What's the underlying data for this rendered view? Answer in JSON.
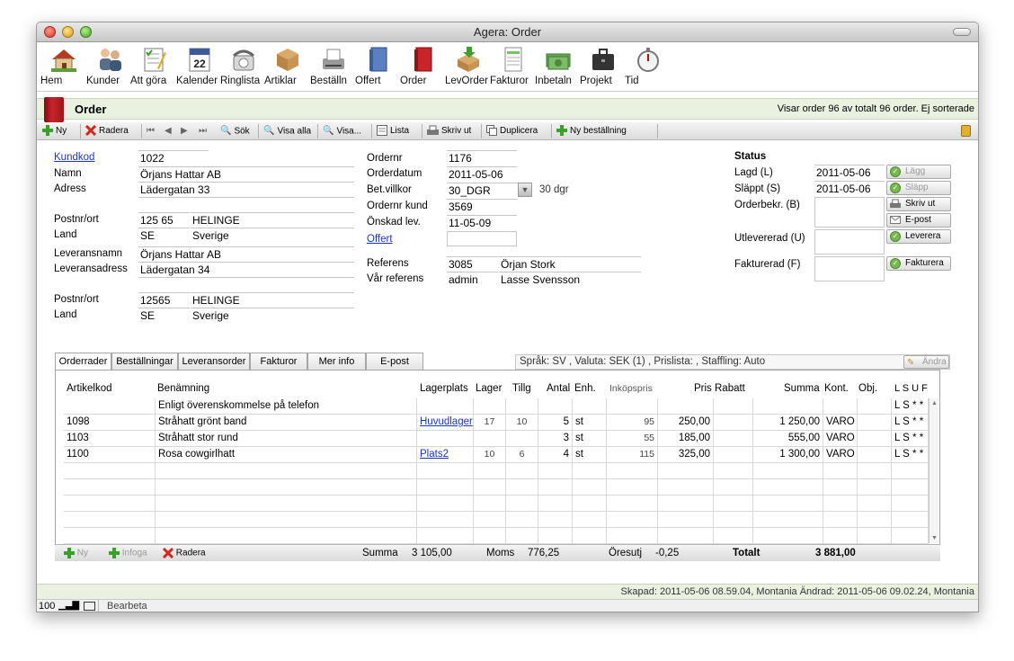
{
  "window": {
    "title": "Agera: Order"
  },
  "toolbar": [
    {
      "label": "Hem",
      "icon": "home-icon"
    },
    {
      "label": "Kunder",
      "icon": "customers-icon"
    },
    {
      "label": "Att göra",
      "icon": "todo-icon"
    },
    {
      "label": "Kalender",
      "icon": "calendar-icon"
    },
    {
      "label": "Ringlista",
      "icon": "phone-icon"
    },
    {
      "label": "Artiklar",
      "icon": "box-icon"
    },
    {
      "label": "Beställn",
      "icon": "fax-icon"
    },
    {
      "label": "Offert",
      "icon": "offer-book-icon"
    },
    {
      "label": "Order",
      "icon": "order-book-icon"
    },
    {
      "label": "LevOrder",
      "icon": "delivery-icon"
    },
    {
      "label": "Fakturor",
      "icon": "invoice-icon"
    },
    {
      "label": "Inbetaln",
      "icon": "money-icon"
    },
    {
      "label": "Projekt",
      "icon": "briefcase-icon"
    },
    {
      "label": "Tid",
      "icon": "stopwatch-icon"
    }
  ],
  "header": {
    "title": "Order",
    "info": "Visar order 96 av totalt 96 order. Ej sorterade"
  },
  "actions": {
    "new": "Ny",
    "delete": "Radera",
    "search": "Sök",
    "show_all": "Visa alla",
    "show": "Visa...",
    "list": "Lista",
    "print": "Skriv ut",
    "duplicate": "Duplicera",
    "new_purchase": "Ny beställning"
  },
  "customer": {
    "kundkod_label": "Kundkod",
    "kundkod": "1022",
    "namn_label": "Namn",
    "namn": "Örjans Hattar AB",
    "adress_label": "Adress",
    "adress": "Lädergatan 33",
    "adress2": "",
    "postnr_label": "Postnr/ort",
    "postnr": "125 65",
    "ort": "HELINGE",
    "land_label": "Land",
    "land_code": "SE",
    "land": "Sverige",
    "levnamn_label": "Leveransnamn",
    "levnamn": "Örjans Hattar AB",
    "levadress_label": "Leveransadress",
    "levadress": "Lädergatan 34",
    "levadress2": "",
    "levpostnr_label": "Postnr/ort",
    "levpostnr": "12565",
    "levort": "HELINGE",
    "levland_label": "Land",
    "levland_code": "SE",
    "levland": "Sverige"
  },
  "order": {
    "ordernr_label": "Ordernr",
    "ordernr": "1176",
    "orderdatum_label": "Orderdatum",
    "orderdatum": "2011-05-06",
    "betvillkor_label": "Bet.villkor",
    "betvillkor": "30_DGR",
    "betvillkor_text": "30 dgr",
    "ordernrkund_label": "Ordernr kund",
    "ordernrkund": "3569",
    "onskadlev_label": "Önskad lev.",
    "onskadlev": "11-05-09",
    "offert_label": "Offert",
    "offert": "",
    "referens_label": "Referens",
    "referens_id": "3085",
    "referens_namn": "Örjan Stork",
    "varref_label": "Vår referens",
    "varref_id": "admin",
    "varref_namn": "Lasse Svensson"
  },
  "status": {
    "title": "Status",
    "lagd_label": "Lagd (L)",
    "lagd": "2011-05-06",
    "lagg_btn": "Lägg",
    "slappt_label": "Släppt (S)",
    "slappt": "2011-05-06",
    "slapp_btn": "Släpp",
    "orderbekr_label": "Orderbekr. (B)",
    "skrivut_btn": "Skriv ut",
    "epost_btn": "E-post",
    "utlevererad_label": "Utlevererad (U)",
    "leverera_btn": "Leverera",
    "fakturerad_label": "Fakturerad (F)",
    "fakturera_btn": "Fakturera"
  },
  "tabs": [
    "Orderrader",
    "Beställningar",
    "Leveransorder",
    "Fakturor",
    "Mer info",
    "E-post"
  ],
  "langbar": "Språk: SV , Valuta: SEK (1) , Prislista:  , Staffling: Auto",
  "andra_btn": "Ändra",
  "grid": {
    "headers": [
      "Artikelkod",
      "Benämning",
      "Lagerplats",
      "Lager",
      "Tillg",
      "Antal",
      "Enh.",
      "Inköpspris",
      "Pris",
      "Rabatt",
      "Summa",
      "Kont.",
      "Obj.",
      "L S U F"
    ],
    "rows": [
      {
        "kod": "",
        "ben": "Enligt överenskommelse på telefon",
        "lagerplats": "",
        "lager": "",
        "tillg": "",
        "antal": "",
        "enh": "",
        "inkop": "",
        "pris": "",
        "rabatt": "",
        "summa": "",
        "kont": "",
        "obj": "",
        "lsuf": "L S * *"
      },
      {
        "kod": "1098",
        "ben": "Stråhatt grönt band",
        "lagerplats": "Huvudlager",
        "lager": "17",
        "tillg": "10",
        "antal": "5",
        "enh": "st",
        "inkop": "95",
        "pris": "250,00",
        "rabatt": "",
        "summa": "1 250,00",
        "kont": "VARO",
        "obj": "",
        "lsuf": "L S * *"
      },
      {
        "kod": "1103",
        "ben": "Stråhatt stor rund",
        "lagerplats": "",
        "lager": "",
        "tillg": "",
        "antal": "3",
        "enh": "st",
        "inkop": "55",
        "pris": "185,00",
        "rabatt": "",
        "summa": "555,00",
        "kont": "VARO",
        "obj": "",
        "lsuf": "L S * *"
      },
      {
        "kod": "1100",
        "ben": "Rosa cowgirlhatt",
        "lagerplats": "Plats2",
        "lager": "10",
        "tillg": "6",
        "antal": "4",
        "enh": "st",
        "inkop": "115",
        "pris": "325,00",
        "rabatt": "",
        "summa": "1 300,00",
        "kont": "VARO",
        "obj": "",
        "lsuf": "L S * *"
      }
    ]
  },
  "footer": {
    "ny": "Ny",
    "infoga": "Infoga",
    "radera": "Radera",
    "summa_label": "Summa",
    "summa": "3 105,00",
    "moms_label": "Moms",
    "moms": "776,25",
    "oresutj_label": "Öresutj",
    "oresutj": "-0,25",
    "totalt_label": "Totalt",
    "totalt": "3 881,00"
  },
  "statusbar": "Skapad: 2011-05-06 08.59.04, Montania Ändrad: 2011-05-06 09.02.24, Montania",
  "bottombar": {
    "zoom": "100",
    "mode": "Bearbeta"
  }
}
